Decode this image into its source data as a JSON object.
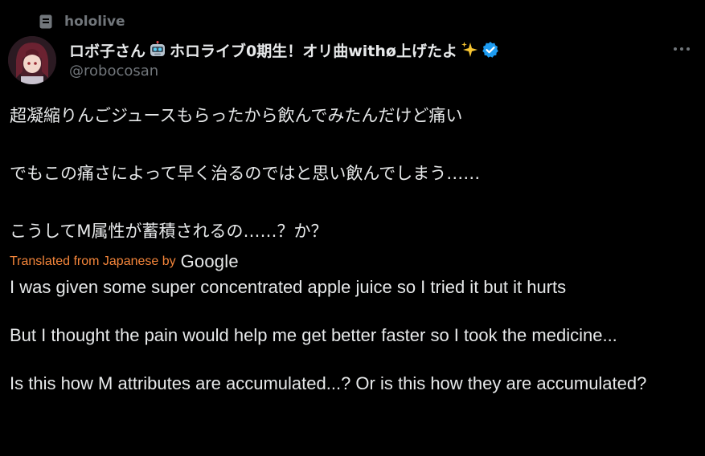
{
  "context": {
    "label": "hololive",
    "icon": "list-icon"
  },
  "author": {
    "display_name": "ロボ子さん",
    "display_name_tail": "ホロライブ0期生！オリ曲withø上げたよ",
    "handle": "@robocosan",
    "verified": true,
    "verified_color": "#1d9bf0"
  },
  "tweet": {
    "japanese": [
      "超凝縮りんごジュースもらったから飲んでみたんだけど痛い",
      "でもこの痛さによって早く治るのではと思い飲んでしまう……",
      "こうしてM属性が蓄積されるの……？か？"
    ],
    "translation_label": "Translated from Japanese by",
    "translation_provider": "Google",
    "english": [
      "I was given some super concentrated apple juice so I tried it but it hurts",
      "But I thought the pain would help me get better faster so I took the medicine...",
      "Is this how M attributes are accumulated...? Or is this how they are accumulated?"
    ]
  },
  "colors": {
    "background": "#000000",
    "text": "#e7e9ea",
    "muted": "#71767b",
    "translation_accent": "#f4853a"
  }
}
